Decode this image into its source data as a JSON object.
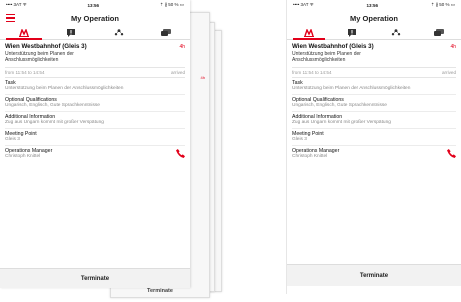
{
  "status_bar": {
    "carrier": "•••• 3AT ᯤ",
    "time": "13:56",
    "battery": "⇡ ∦ 50 % ▭"
  },
  "app_title": "My Operation",
  "tabs": [
    {
      "icon": "workplace-icon",
      "active": true
    },
    {
      "icon": "info-icon",
      "active": false
    },
    {
      "icon": "team-icon",
      "active": false
    },
    {
      "icon": "chat-icon",
      "active": false
    }
  ],
  "operation": {
    "location": "Wien Westbahnhof (Gleis 3)",
    "duration": "4h",
    "description": "Unterstützung beim Planen der Anschlussmöglichkeiten",
    "time_range": "from 11:54 to 14:54",
    "state": "arrived"
  },
  "sections": [
    {
      "label": "Task",
      "value": "Unterstützung beim Planen der Anschlussmöglichkeiten"
    },
    {
      "label": "Optional Qualifications",
      "value": "Ungarisch, Englisch, Gute Sprachkenntnisse"
    },
    {
      "label": "Additional Information",
      "value": "Zug aus Ungarn kommt mit großer Verspätung"
    },
    {
      "label": "Meeting Point",
      "value": "Gleis 3"
    }
  ],
  "manager": {
    "label": "Operations Manager",
    "name": "Christoph Knittel"
  },
  "terminate_label": "Terminate",
  "ghost": {
    "duration": "4h",
    "state": "rived",
    "terminate": "Terminate"
  },
  "colors": {
    "accent": "#e2001a"
  }
}
